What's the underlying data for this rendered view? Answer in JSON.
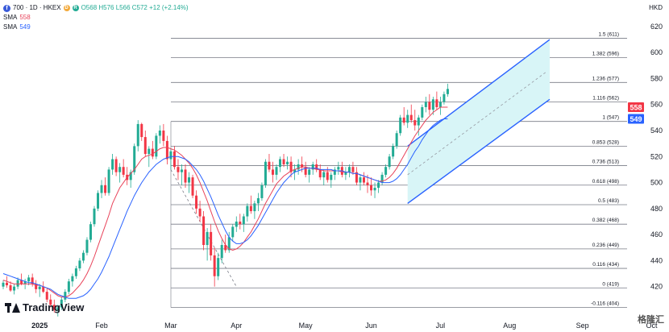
{
  "header": {
    "symbol_badge": "f",
    "title": "700 · 1D · HKEX",
    "d_badge": "D",
    "r_badge": "R",
    "ohlc": "O568 H576 L566 C572 +12 (+2.14%)",
    "currency": "HKD"
  },
  "legend": [
    {
      "label": "SMA",
      "value": "558",
      "color": "#e8435a"
    },
    {
      "label": "SMA",
      "value": "549",
      "color": "#2962ff"
    }
  ],
  "watermark": "TradingView",
  "corner_logo": "格隆汇",
  "colors": {
    "up": "#22ab94",
    "down": "#f23645",
    "fib": "#787b86",
    "channel_fill": "#d8f5f7",
    "channel_line": "#2962ff"
  },
  "chart_data": {
    "type": "candlestick",
    "ylim": [
      395,
      628
    ],
    "y_ticks": [
      420,
      440,
      460,
      480,
      500,
      520,
      540,
      560,
      580,
      600,
      620
    ],
    "x_labels": [
      {
        "label": "2025",
        "index": 10
      },
      {
        "label": "Feb",
        "index": 27
      },
      {
        "label": "Mar",
        "index": 46
      },
      {
        "label": "Apr",
        "index": 64
      },
      {
        "label": "May",
        "index": 83
      },
      {
        "label": "Jun",
        "index": 101
      },
      {
        "label": "Jul",
        "index": 120
      },
      {
        "label": "Aug",
        "index": 139
      },
      {
        "label": "Sep",
        "index": 159
      },
      {
        "label": "Oct",
        "index": 178
      }
    ],
    "price_labels": [
      {
        "value": 558,
        "text": "558",
        "color": "#f23645"
      },
      {
        "value": 549,
        "text": "549",
        "color": "#2962ff"
      }
    ],
    "fib_levels": [
      {
        "label": "1.5 (611)",
        "value": 611
      },
      {
        "label": "1.382 (596)",
        "value": 596
      },
      {
        "label": "1.236 (577)",
        "value": 577
      },
      {
        "label": "1.116 (562)",
        "value": 562
      },
      {
        "label": "1 (547)",
        "value": 547
      },
      {
        "label": "0.853 (528)",
        "value": 528
      },
      {
        "label": "0.736 (513)",
        "value": 513
      },
      {
        "label": "0.618 (498)",
        "value": 498
      },
      {
        "label": "0.5 (483)",
        "value": 483
      },
      {
        "label": "0.382 (468)",
        "value": 468
      },
      {
        "label": "0.236 (449)",
        "value": 449
      },
      {
        "label": "0.116 (434)",
        "value": 434
      },
      {
        "label": "0 (419)",
        "value": 419
      },
      {
        "label": "-0.116 (404)",
        "value": 404
      }
    ],
    "candles": [
      [
        420,
        425,
        418,
        423
      ],
      [
        423,
        428,
        419,
        421
      ],
      [
        421,
        424,
        416,
        417
      ],
      [
        417,
        422,
        414,
        420
      ],
      [
        420,
        427,
        418,
        425
      ],
      [
        425,
        430,
        421,
        422
      ],
      [
        422,
        426,
        418,
        424
      ],
      [
        424,
        429,
        421,
        427
      ],
      [
        427,
        430,
        420,
        422
      ],
      [
        422,
        425,
        415,
        418
      ],
      [
        418,
        422,
        412,
        420
      ],
      [
        420,
        424,
        415,
        416
      ],
      [
        416,
        419,
        408,
        410
      ],
      [
        410,
        414,
        404,
        406
      ],
      [
        406,
        410,
        400,
        402
      ],
      [
        402,
        406,
        397,
        404
      ],
      [
        404,
        412,
        402,
        410
      ],
      [
        410,
        418,
        408,
        416
      ],
      [
        416,
        426,
        414,
        424
      ],
      [
        424,
        430,
        420,
        428
      ],
      [
        428,
        436,
        426,
        434
      ],
      [
        434,
        442,
        432,
        440
      ],
      [
        440,
        448,
        438,
        446
      ],
      [
        446,
        458,
        444,
        456
      ],
      [
        456,
        470,
        454,
        468
      ],
      [
        468,
        482,
        466,
        480
      ],
      [
        480,
        494,
        478,
        492
      ],
      [
        492,
        502,
        488,
        498
      ],
      [
        498,
        504,
        490,
        492
      ],
      [
        492,
        512,
        490,
        510
      ],
      [
        510,
        522,
        506,
        518
      ],
      [
        518,
        520,
        505,
        508
      ],
      [
        508,
        515,
        500,
        512
      ],
      [
        512,
        518,
        504,
        506
      ],
      [
        506,
        512,
        498,
        502
      ],
      [
        502,
        510,
        496,
        508
      ],
      [
        508,
        530,
        506,
        528
      ],
      [
        528,
        548,
        524,
        545
      ],
      [
        545,
        546,
        532,
        535
      ],
      [
        535,
        540,
        520,
        522
      ],
      [
        522,
        528,
        512,
        526
      ],
      [
        526,
        532,
        518,
        520
      ],
      [
        520,
        538,
        518,
        536
      ],
      [
        536,
        544,
        530,
        540
      ],
      [
        540,
        545,
        528,
        532
      ],
      [
        532,
        536,
        514,
        518
      ],
      [
        518,
        526,
        510,
        524
      ],
      [
        524,
        528,
        510,
        512
      ],
      [
        512,
        518,
        502,
        508
      ],
      [
        508,
        514,
        498,
        510
      ],
      [
        510,
        514,
        496,
        500
      ],
      [
        500,
        508,
        492,
        504
      ],
      [
        504,
        506,
        488,
        490
      ],
      [
        490,
        494,
        476,
        480
      ],
      [
        480,
        486,
        470,
        474
      ],
      [
        474,
        478,
        448,
        452
      ],
      [
        452,
        465,
        440,
        462
      ],
      [
        462,
        468,
        440,
        444
      ],
      [
        444,
        450,
        420,
        428
      ],
      [
        428,
        446,
        425,
        442
      ],
      [
        442,
        456,
        438,
        452
      ],
      [
        452,
        460,
        446,
        448
      ],
      [
        448,
        462,
        446,
        458
      ],
      [
        458,
        468,
        455,
        466
      ],
      [
        466,
        474,
        462,
        470
      ],
      [
        470,
        476,
        464,
        468
      ],
      [
        468,
        476,
        462,
        474
      ],
      [
        474,
        484,
        470,
        482
      ],
      [
        482,
        490,
        476,
        478
      ],
      [
        478,
        486,
        472,
        484
      ],
      [
        484,
        492,
        478,
        488
      ],
      [
        488,
        500,
        486,
        498
      ],
      [
        498,
        518,
        496,
        516
      ],
      [
        516,
        522,
        508,
        510
      ],
      [
        510,
        516,
        500,
        506
      ],
      [
        506,
        514,
        502,
        512
      ],
      [
        512,
        520,
        508,
        518
      ],
      [
        518,
        522,
        512,
        514
      ],
      [
        514,
        520,
        510,
        516
      ],
      [
        516,
        520,
        504,
        508
      ],
      [
        508,
        514,
        502,
        510
      ],
      [
        510,
        518,
        506,
        514
      ],
      [
        514,
        520,
        508,
        512
      ],
      [
        512,
        516,
        504,
        506
      ],
      [
        506,
        512,
        500,
        510
      ],
      [
        510,
        516,
        506,
        514
      ],
      [
        514,
        518,
        508,
        510
      ],
      [
        510,
        514,
        502,
        504
      ],
      [
        504,
        510,
        498,
        508
      ],
      [
        508,
        512,
        500,
        502
      ],
      [
        502,
        508,
        496,
        506
      ],
      [
        506,
        512,
        502,
        510
      ],
      [
        510,
        516,
        506,
        512
      ],
      [
        512,
        516,
        504,
        506
      ],
      [
        506,
        512,
        502,
        508
      ],
      [
        508,
        514,
        504,
        512
      ],
      [
        512,
        516,
        506,
        508
      ],
      [
        508,
        512,
        498,
        500
      ],
      [
        500,
        506,
        494,
        504
      ],
      [
        504,
        508,
        498,
        500
      ],
      [
        500,
        506,
        492,
        498
      ],
      [
        498,
        504,
        490,
        494
      ],
      [
        494,
        500,
        488,
        496
      ],
      [
        496,
        502,
        492,
        500
      ],
      [
        500,
        508,
        498,
        506
      ],
      [
        506,
        514,
        504,
        512
      ],
      [
        512,
        522,
        510,
        520
      ],
      [
        520,
        530,
        518,
        528
      ],
      [
        528,
        540,
        526,
        538
      ],
      [
        538,
        552,
        536,
        550
      ],
      [
        550,
        558,
        544,
        546
      ],
      [
        546,
        556,
        542,
        552
      ],
      [
        552,
        560,
        546,
        548
      ],
      [
        548,
        556,
        540,
        544
      ],
      [
        544,
        552,
        536,
        550
      ],
      [
        550,
        560,
        548,
        558
      ],
      [
        558,
        566,
        554,
        562
      ],
      [
        562,
        568,
        552,
        556
      ],
      [
        556,
        566,
        552,
        564
      ],
      [
        564,
        570,
        556,
        558
      ],
      [
        558,
        566,
        552,
        562
      ],
      [
        562,
        570,
        560,
        568
      ],
      [
        568,
        576,
        566,
        572
      ]
    ],
    "series": [
      {
        "name": "SMA",
        "color": "#e8435a",
        "values": [
          425,
          424,
          423,
          422,
          422,
          422,
          422,
          422,
          422,
          421,
          421,
          420,
          419,
          417,
          415,
          413,
          412,
          412,
          413,
          415,
          418,
          421,
          425,
          430,
          436,
          443,
          451,
          459,
          467,
          475,
          484,
          490,
          496,
          500,
          504,
          507,
          510,
          514,
          518,
          520,
          521,
          522,
          524,
          526,
          527,
          527,
          526,
          525,
          523,
          521,
          518,
          515,
          511,
          506,
          500,
          493,
          486,
          478,
          470,
          463,
          457,
          452,
          449,
          448,
          449,
          451,
          454,
          458,
          462,
          467,
          472,
          478,
          484,
          489,
          494,
          499,
          502,
          505,
          507,
          509,
          510,
          511,
          512,
          512,
          511,
          511,
          510,
          510,
          509,
          509,
          509,
          509,
          509,
          508,
          508,
          508,
          507,
          507,
          506,
          505,
          504,
          503,
          502,
          501,
          501,
          502,
          504,
          507,
          511,
          516,
          521,
          526,
          531,
          536,
          540,
          544,
          548,
          551,
          554,
          556,
          558,
          558,
          558
        ]
      },
      {
        "name": "SMA",
        "color": "#2962ff",
        "values": [
          430,
          429,
          428,
          427,
          426,
          425,
          424,
          423,
          423,
          422,
          421,
          420,
          419,
          418,
          416,
          414,
          413,
          412,
          411,
          411,
          411,
          412,
          413,
          415,
          418,
          422,
          426,
          431,
          437,
          443,
          450,
          457,
          464,
          471,
          478,
          484,
          490,
          495,
          500,
          504,
          508,
          511,
          514,
          516,
          518,
          519,
          520,
          520,
          520,
          519,
          518,
          516,
          513,
          510,
          506,
          501,
          495,
          489,
          482,
          475,
          469,
          463,
          458,
          455,
          453,
          453,
          454,
          456,
          459,
          463,
          467,
          472,
          477,
          482,
          487,
          492,
          496,
          500,
          503,
          506,
          508,
          509,
          510,
          511,
          511,
          511,
          511,
          510,
          510,
          510,
          510,
          509,
          509,
          509,
          508,
          508,
          507,
          507,
          506,
          505,
          504,
          503,
          502,
          501,
          500,
          500,
          500,
          501,
          503,
          506,
          510,
          514,
          519,
          524,
          528,
          533,
          537,
          541,
          544,
          546,
          548,
          549,
          549
        ]
      }
    ],
    "channel": {
      "upper": [
        {
          "i": 111,
          "v": 528
        },
        {
          "i": 150,
          "v": 610
        }
      ],
      "lower": [
        {
          "i": 111,
          "v": 484
        },
        {
          "i": 150,
          "v": 564
        }
      ],
      "mid_dashed": [
        {
          "i": 111,
          "v": 506
        },
        {
          "i": 149,
          "v": 585
        }
      ]
    },
    "dashed_trend": [
      {
        "i": 46,
        "v": 510
      },
      {
        "i": 64,
        "v": 420
      }
    ]
  }
}
